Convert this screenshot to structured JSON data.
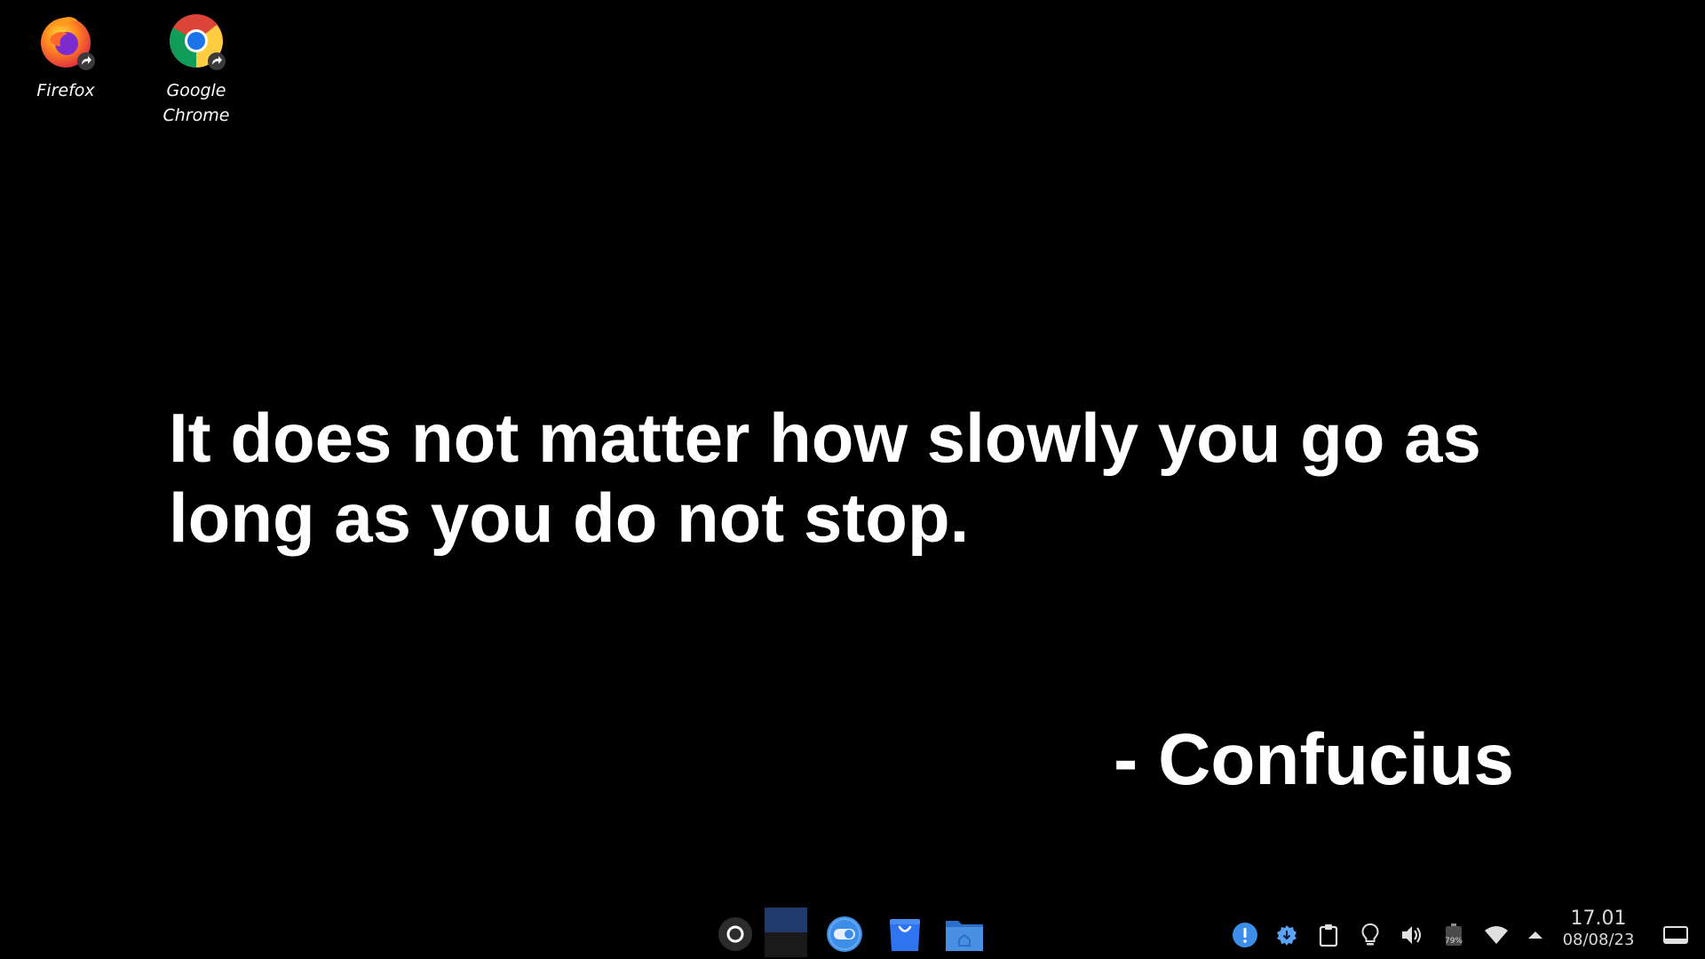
{
  "desktop": {
    "background_color": "#000000",
    "icons": [
      {
        "label": "Firefox",
        "icon": "firefox-icon"
      },
      {
        "label": "Google Chrome",
        "icon": "chrome-icon"
      }
    ]
  },
  "wallpaper": {
    "quote": "It does not matter how slowly you go as long as you do not stop.",
    "author": "- Confucius",
    "text_color": "#ffffff"
  },
  "taskbar": {
    "dock": [
      {
        "icon": "app-launcher-icon"
      },
      {
        "icon": "workspace-switcher-icon"
      },
      {
        "icon": "settings-toggle-icon"
      },
      {
        "icon": "software-store-icon"
      },
      {
        "icon": "file-manager-icon"
      }
    ],
    "tray": [
      {
        "icon": "notification-alert-icon"
      },
      {
        "icon": "system-update-icon"
      },
      {
        "icon": "clipboard-icon"
      },
      {
        "icon": "lightbulb-icon"
      },
      {
        "icon": "volume-icon"
      },
      {
        "icon": "battery-icon",
        "label": "79%"
      },
      {
        "icon": "wifi-icon"
      },
      {
        "icon": "expand-tray-icon"
      }
    ],
    "clock": {
      "time": "17.01",
      "date": "08/08/23"
    },
    "show_desktop_icon": "show-desktop-icon",
    "accent_color": "#3d8ee8"
  }
}
